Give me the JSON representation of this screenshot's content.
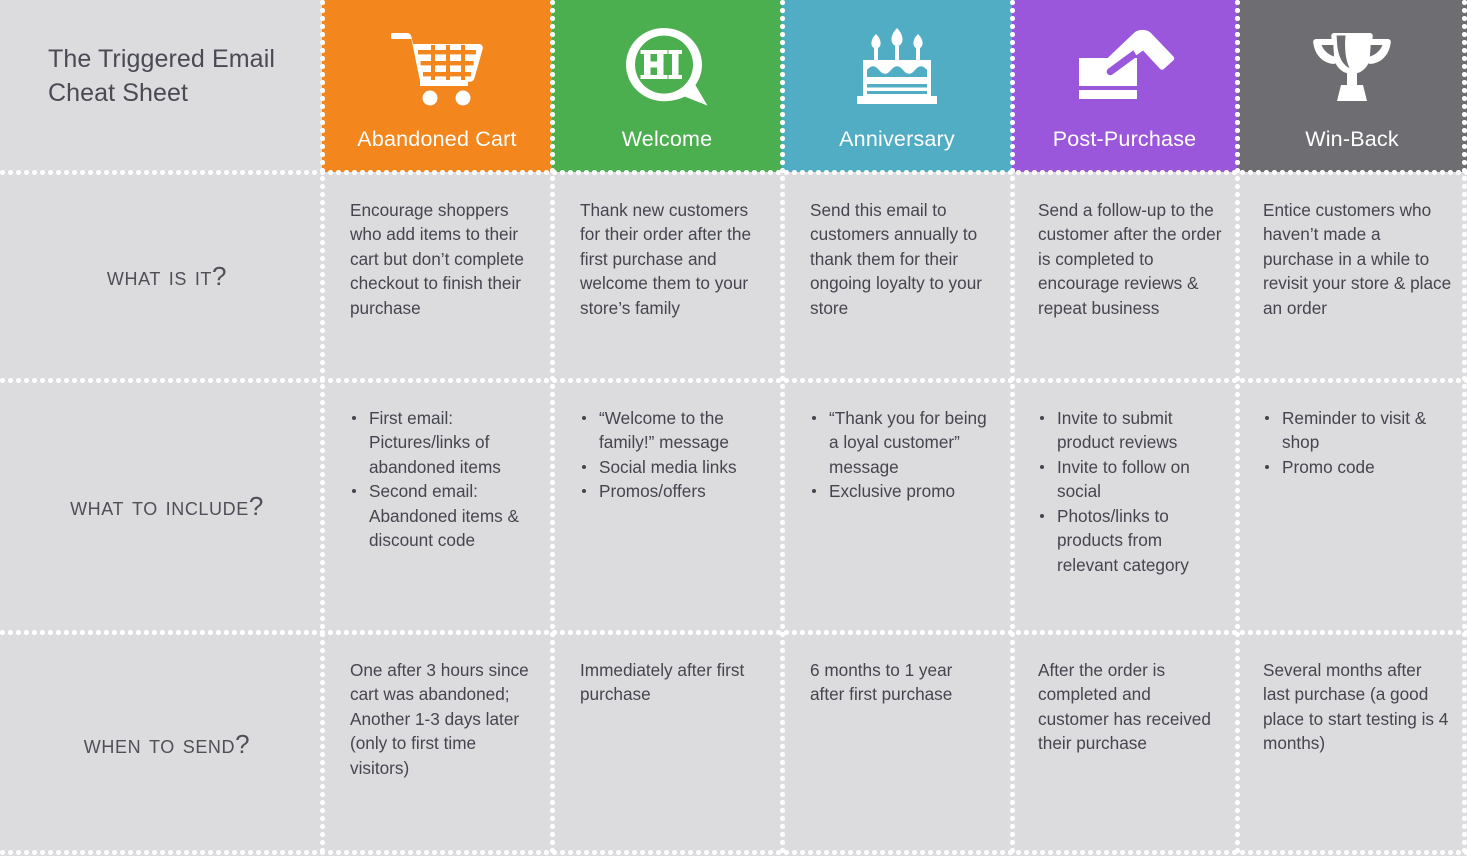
{
  "title": {
    "line1": "The Triggered Email",
    "line2": "Cheat Sheet"
  },
  "colors": {
    "background": "#dcdcde",
    "text": "#45454f",
    "abandoned_cart": "#F3861C",
    "welcome": "#4CAF4F",
    "anniversary": "#51ADC4",
    "post_purchase": "#9B57DB",
    "win_back": "#6E6E72",
    "separator": "#ffffff"
  },
  "columns": [
    {
      "label": "Abandoned Cart",
      "icon": "shopping-cart-icon",
      "color": "#F3861C"
    },
    {
      "label": "Welcome",
      "icon": "hi-speech-bubble-icon",
      "color": "#4CAF4F"
    },
    {
      "label": "Anniversary",
      "icon": "birthday-cake-icon",
      "color": "#51ADC4"
    },
    {
      "label": "Post-Purchase",
      "icon": "hand-credit-card-icon",
      "color": "#9B57DB"
    },
    {
      "label": "Win-Back",
      "icon": "trophy-icon",
      "color": "#6E6E72"
    }
  ],
  "rows": [
    {
      "label": "What is it?",
      "type": "paragraph",
      "cells": [
        "Encourage shoppers who add items to their cart but don’t complete checkout to finish their purchase",
        "Thank new customers for their order after the first purchase and welcome them to your store’s family",
        "Send this email to customers annually to thank them for their ongoing loyalty to your store",
        "Send a follow-up to the customer after the order is completed to encourage reviews & repeat business",
        "Entice customers who haven’t made a purchase in a while to revisit your store & place an order"
      ]
    },
    {
      "label": "What to include?",
      "type": "bullets",
      "cells": [
        [
          "First email: Pictures/links of abandoned items",
          "Second email: Abandoned items & discount code"
        ],
        [
          "“Welcome to the family!” message",
          "Social media links",
          "Promos/offers"
        ],
        [
          "“Thank you for being a loyal customer” message",
          "Exclusive promo"
        ],
        [
          "Invite to submit product reviews",
          "Invite to follow on social",
          "Photos/links to products from relevant category"
        ],
        [
          "Reminder to visit & shop",
          "Promo code"
        ]
      ]
    },
    {
      "label": "When to Send?",
      "type": "paragraph",
      "cells": [
        "One after 3 hours since cart was abandoned; Another 1-3 days later (only to first time visitors)",
        "Immediately after first purchase",
        "6 months to 1 year after first purchase",
        "After the order is completed and customer has received their purchase",
        "Several months after last purchase (a good place to start testing is 4 months)"
      ]
    }
  ]
}
